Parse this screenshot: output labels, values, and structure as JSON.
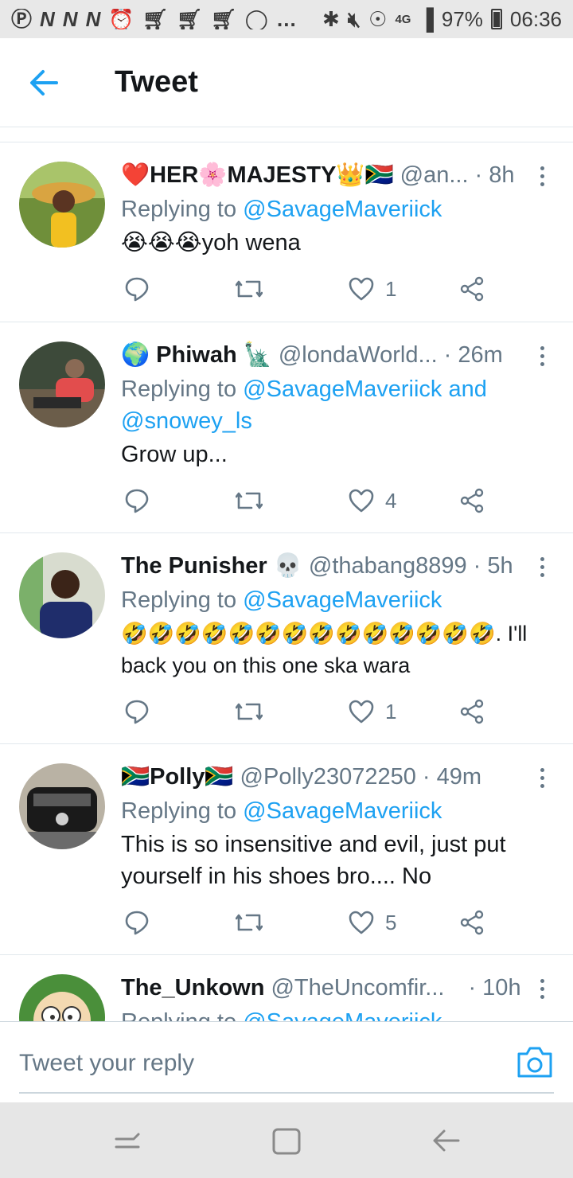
{
  "status_bar": {
    "left_icons": [
      "facebook-icon",
      "n-icon",
      "n-icon",
      "n-icon",
      "alarm-icon",
      "cart-icon",
      "cart-icon",
      "cart-icon",
      "vpn-icon"
    ],
    "more": "…",
    "network": "4G",
    "battery": "97%",
    "time": "06:36"
  },
  "header": {
    "title": "Tweet",
    "accent": "#1da1f2"
  },
  "tweets": [
    {
      "name": "❤️HER🌸MAJESTY👑🇿🇦",
      "handle": "@an...",
      "time": "· 8h",
      "replying_prefix": "Replying to ",
      "replying_to": "@SavageMaveriick",
      "text": "😭😭😭yoh wena",
      "likes": "1"
    },
    {
      "name": "🌍 Phiwah 🗽",
      "handle": "@londaWorld...",
      "time": "· 26m",
      "replying_prefix": "Replying to ",
      "replying_to": "@SavageMaveriick and @snowey_ls",
      "text": "Grow up...",
      "likes": "4"
    },
    {
      "name": "The Punisher 💀",
      "handle": "@thabang8899",
      "time": "· 5h",
      "replying_prefix": "Replying to ",
      "replying_to": "@SavageMaveriick",
      "text": "🤣🤣🤣🤣🤣🤣🤣🤣🤣🤣🤣🤣🤣🤣. I'll back you on this one ska wara",
      "likes": "1"
    },
    {
      "name": "🇿🇦Polly🇿🇦",
      "handle": "@Polly23072250",
      "time": "· 49m",
      "replying_prefix": "Replying to ",
      "replying_to": "@SavageMaveriick",
      "text": "This is so insensitive and evil, just put yourself in his shoes bro.... No",
      "likes": "5"
    },
    {
      "name": "The_Unkown",
      "handle": "@TheUncomfir...",
      "time": "· 10h",
      "replying_prefix": "Replying to ",
      "replying_to": "@SavageMaveriick",
      "text": "",
      "likes": ""
    }
  ],
  "compose": {
    "placeholder": "Tweet your reply"
  }
}
